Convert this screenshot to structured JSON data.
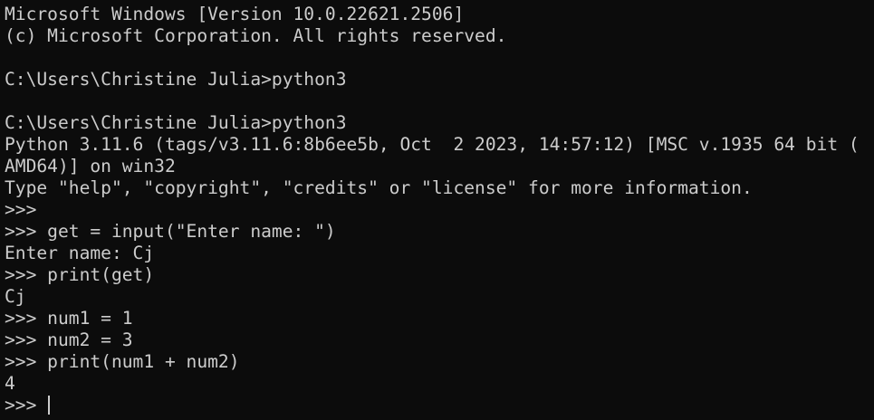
{
  "terminal": {
    "lines": [
      "Microsoft Windows [Version 10.0.22621.2506]",
      "(c) Microsoft Corporation. All rights reserved.",
      "",
      "C:\\Users\\Christine Julia>python3",
      "",
      "C:\\Users\\Christine Julia>python3",
      "Python 3.11.6 (tags/v3.11.6:8b6ee5b, Oct  2 2023, 14:57:12) [MSC v.1935 64 bit (",
      "AMD64)] on win32",
      "Type \"help\", \"copyright\", \"credits\" or \"license\" for more information.",
      ">>>",
      ">>> get = input(\"Enter name: \")",
      "Enter name: Cj",
      ">>> print(get)",
      "Cj",
      ">>> num1 = 1",
      ">>> num2 = 3",
      ">>> print(num1 + num2)",
      "4"
    ],
    "prompt": ">>> "
  },
  "colors": {
    "background": "#0c0c0c",
    "foreground": "#cccccc"
  }
}
